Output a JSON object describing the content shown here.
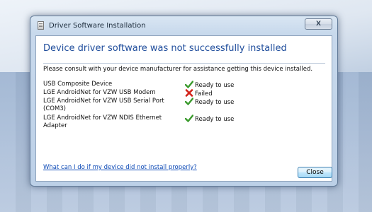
{
  "window": {
    "title": "Driver Software Installation",
    "close_glyph": "X"
  },
  "headline": "Device driver software was not successfully installed",
  "instruction": "Please consult with your device manufacturer for assistance getting this device installed.",
  "devices": [
    {
      "name": "USB Composite Device",
      "status": "Ready to use",
      "icon": "check-icon"
    },
    {
      "name": "LGE AndroidNet for VZW USB Modem",
      "status": "Failed",
      "icon": "error-x-icon"
    },
    {
      "name": "LGE AndroidNet for VZW USB Serial Port (COM3)",
      "status": "Ready to use",
      "icon": "check-icon"
    },
    {
      "name": "LGE AndroidNet for VZW NDIS Ethernet Adapter",
      "status": "Ready to use",
      "icon": "check-icon"
    }
  ],
  "help_link": "What can I do if my device did not install properly?",
  "buttons": {
    "close": "Close"
  },
  "colors": {
    "headline": "#1f4d9c",
    "link": "#0c49b6",
    "success": "#3a9a2c",
    "error": "#d2231a"
  }
}
